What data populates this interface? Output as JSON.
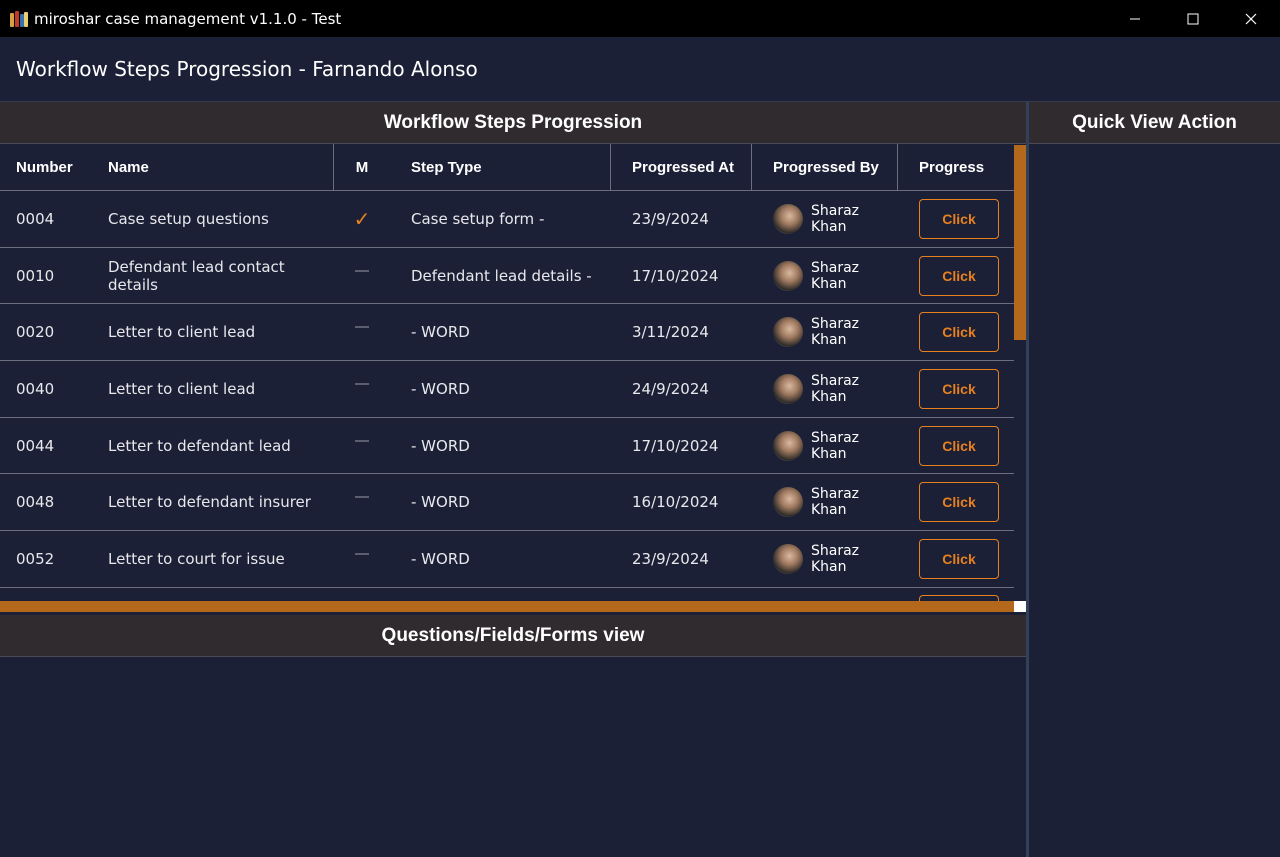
{
  "window": {
    "title": "miroshar case management v1.1.0 - Test",
    "minimize_glyph": "─",
    "maximize_glyph": "☐",
    "close_glyph": "✕"
  },
  "page": {
    "title": "Workflow Steps Progression - Farnando Alonso"
  },
  "workflow": {
    "header": "Workflow Steps Progression",
    "columns": {
      "number": "Number",
      "name": "Name",
      "m": "M",
      "step_type": "Step Type",
      "progressed_at": "Progressed At",
      "progressed_by": "Progressed By",
      "progress": "Progress"
    },
    "rows": [
      {
        "number": "0004",
        "name": "Case setup questions",
        "m": true,
        "step_type": "Case setup form -",
        "progressed_at": "23/9/2024",
        "progressed_by": "Sharaz Khan",
        "button": "Click"
      },
      {
        "number": "0010",
        "name": "Defendant lead contact details",
        "m": false,
        "step_type": "Defendant lead details -",
        "progressed_at": "17/10/2024",
        "progressed_by": "Sharaz Khan",
        "button": "Click"
      },
      {
        "number": "0020",
        "name": "Letter to client lead",
        "m": false,
        "step_type": "- WORD",
        "progressed_at": "3/11/2024",
        "progressed_by": "Sharaz Khan",
        "button": "Click"
      },
      {
        "number": "0040",
        "name": "Letter to client lead",
        "m": false,
        "step_type": "- WORD",
        "progressed_at": "24/9/2024",
        "progressed_by": "Sharaz Khan",
        "button": "Click"
      },
      {
        "number": "0044",
        "name": "Letter to defendant lead",
        "m": false,
        "step_type": "- WORD",
        "progressed_at": "17/10/2024",
        "progressed_by": "Sharaz Khan",
        "button": "Click"
      },
      {
        "number": "0048",
        "name": "Letter to defendant insurer",
        "m": false,
        "step_type": "- WORD",
        "progressed_at": "16/10/2024",
        "progressed_by": "Sharaz Khan",
        "button": "Click"
      },
      {
        "number": "0052",
        "name": "Letter to court for issue",
        "m": false,
        "step_type": "- WORD",
        "progressed_at": "23/9/2024",
        "progressed_by": "Sharaz Khan",
        "button": "Click"
      }
    ],
    "check_glyph": "✓"
  },
  "questions": {
    "header": "Questions/Fields/Forms view"
  },
  "quick_view": {
    "header": "Quick View Action"
  },
  "colors": {
    "background": "#1b2036",
    "section_header": "#302b2e",
    "accent": "#e8801e",
    "scrollbar": "#b4681b"
  }
}
